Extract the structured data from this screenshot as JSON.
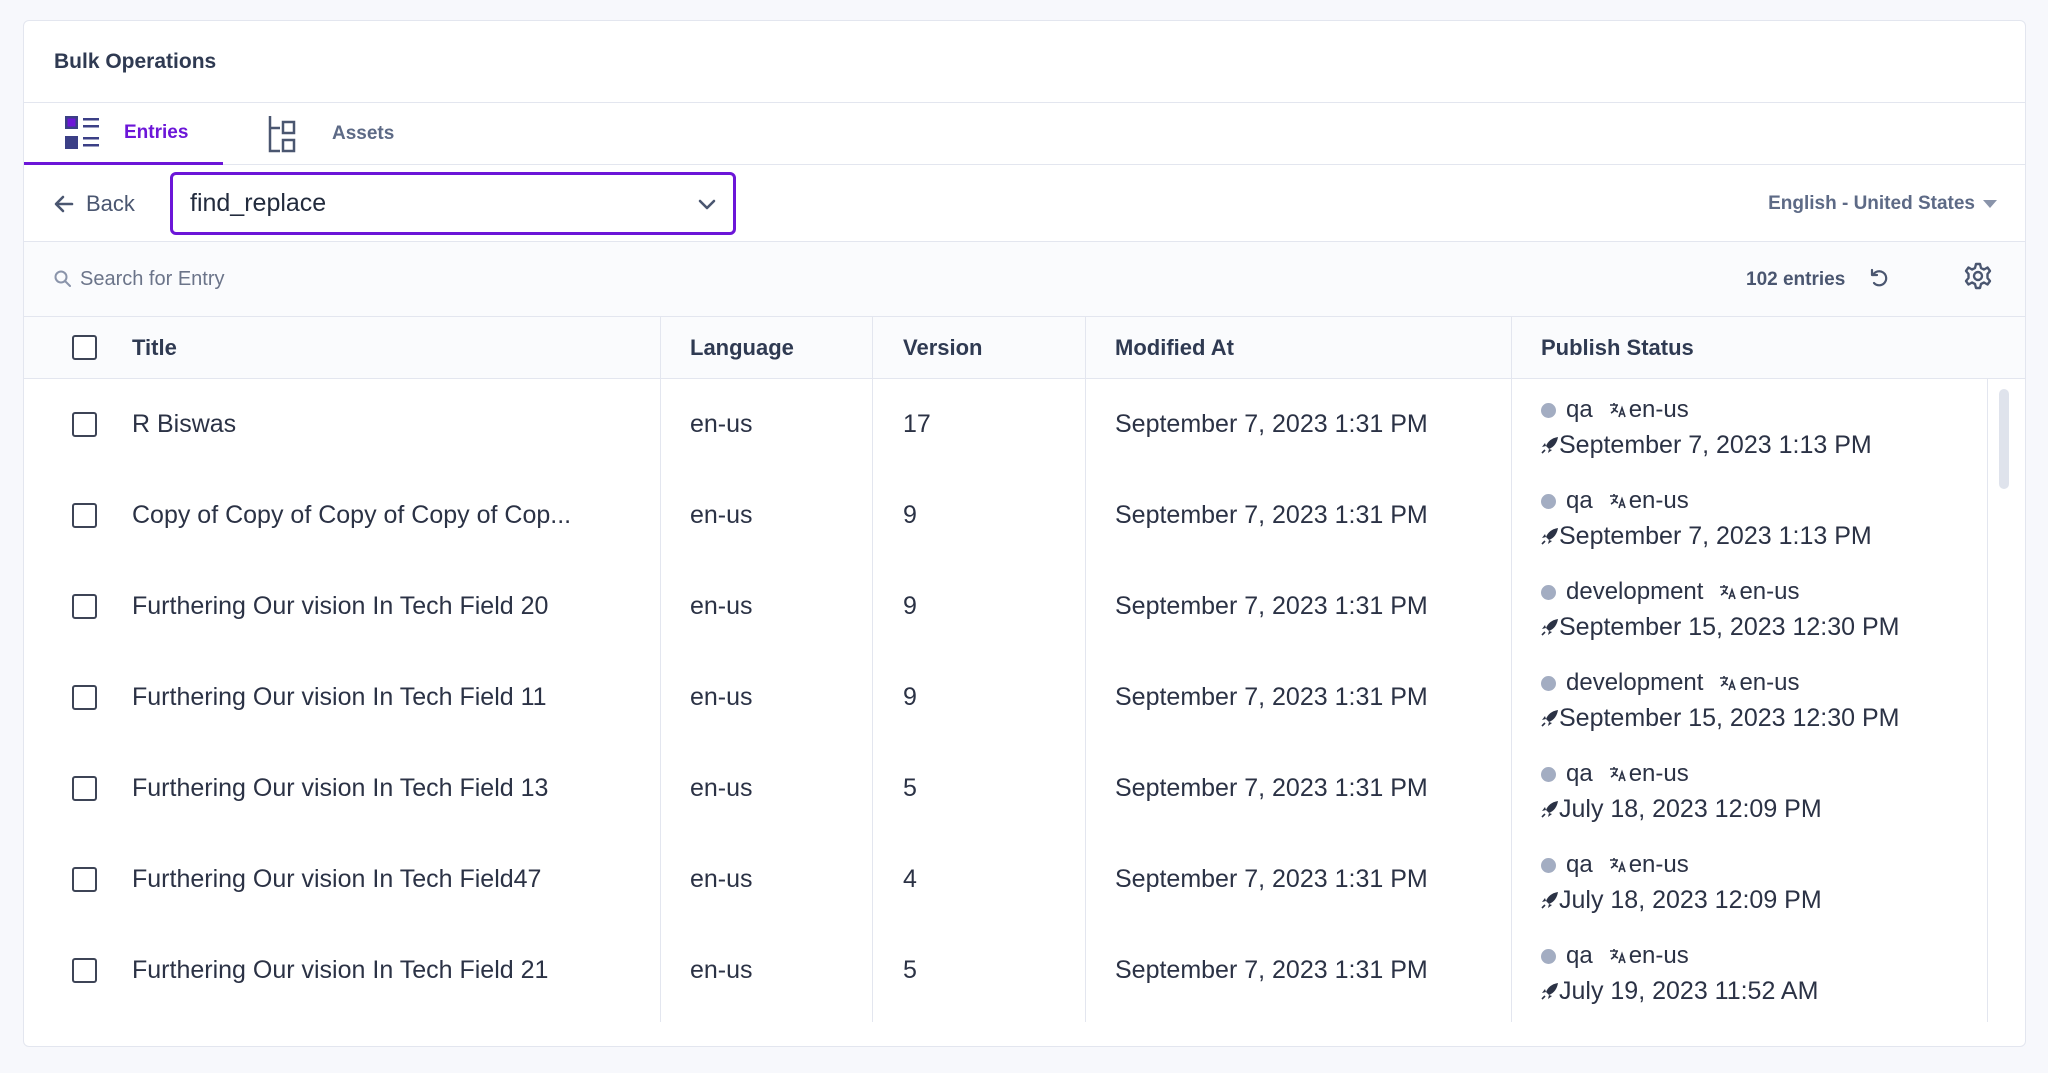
{
  "panel": {
    "title": "Bulk Operations"
  },
  "tabs": [
    {
      "label": "Entries",
      "icon": "entries-icon",
      "active": true
    },
    {
      "label": "Assets",
      "icon": "assets-icon",
      "active": false
    }
  ],
  "toolbar": {
    "back_label": "Back",
    "selected_value": "find_replace",
    "locale": "English - United States"
  },
  "search": {
    "placeholder": "Search for Entry",
    "entries_count": "102 entries"
  },
  "table": {
    "columns": [
      "Title",
      "Language",
      "Version",
      "Modified At",
      "Publish Status"
    ],
    "rows": [
      {
        "title": "R Biswas",
        "language": "en-us",
        "version": "17",
        "modified": "September 7, 2023 1:31 PM",
        "env": "qa",
        "locale": "en-us",
        "published": "September 7, 2023 1:13 PM"
      },
      {
        "title": "Copy of Copy of Copy of Copy of Cop...",
        "language": "en-us",
        "version": "9",
        "modified": "September 7, 2023 1:31 PM",
        "env": "qa",
        "locale": "en-us",
        "published": "September 7, 2023 1:13 PM"
      },
      {
        "title": "Furthering Our vision In Tech Field 20",
        "language": "en-us",
        "version": "9",
        "modified": "September 7, 2023 1:31 PM",
        "env": "development",
        "locale": "en-us",
        "published": "September 15, 2023 12:30 PM"
      },
      {
        "title": "Furthering Our vision In Tech Field 11",
        "language": "en-us",
        "version": "9",
        "modified": "September 7, 2023 1:31 PM",
        "env": "development",
        "locale": "en-us",
        "published": "September 15, 2023 12:30 PM"
      },
      {
        "title": "Furthering Our vision In Tech Field 13",
        "language": "en-us",
        "version": "5",
        "modified": "September 7, 2023 1:31 PM",
        "env": "qa",
        "locale": "en-us",
        "published": "July 18, 2023 12:09 PM"
      },
      {
        "title": "Furthering Our vision In Tech Field47",
        "language": "en-us",
        "version": "4",
        "modified": "September 7, 2023 1:31 PM",
        "env": "qa",
        "locale": "en-us",
        "published": "July 18, 2023 12:09 PM"
      },
      {
        "title": "Furthering Our vision In Tech Field 21",
        "language": "en-us",
        "version": "5",
        "modified": "September 7, 2023 1:31 PM",
        "env": "qa",
        "locale": "en-us",
        "published": "July 19, 2023 11:52 AM"
      }
    ]
  },
  "colors": {
    "accent": "#6c16d8",
    "status_dot": "#a3adc2"
  }
}
